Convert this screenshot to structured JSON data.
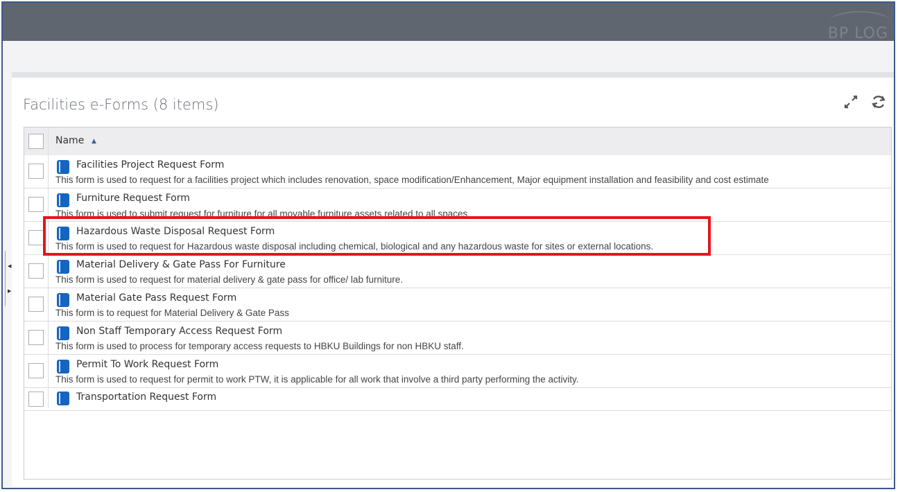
{
  "header": {
    "logo_text": "BP LOG"
  },
  "panel": {
    "title": "Facilities e-Forms (8 items)",
    "expand_icon": "expand-icon",
    "refresh_icon": "refresh-icon"
  },
  "grid": {
    "column_name": "Name",
    "sort": "ascending",
    "rows": [
      {
        "name": "Facilities Project Request Form",
        "description": "This form is used to request for a facilities project which includes renovation, space modification/Enhancement, Major equipment installation and feasibility and cost estimate"
      },
      {
        "name": "Furniture Request Form",
        "description": "This form is used to submit request for furniture for all movable furniture assets related to all spaces"
      },
      {
        "name": "Hazardous Waste Disposal Request Form",
        "description": "This form is used to request for Hazardous waste disposal including chemical, biological and any hazardous waste for sites or external locations."
      },
      {
        "name": "Material Delivery & Gate Pass For Furniture",
        "description": "This form is used to request for material delivery & gate pass for office/ lab furniture."
      },
      {
        "name": "Material Gate Pass Request Form",
        "description": "This form is to request for Material Delivery & Gate Pass"
      },
      {
        "name": "Non Staff Temporary Access Request Form",
        "description": "This form is used to process for temporary access requests to HBKU Buildings for non HBKU staff."
      },
      {
        "name": "Permit To Work Request Form",
        "description": "This form is used to request for permit to work PTW, it is applicable for all work that involve a third party performing the activity."
      },
      {
        "name": "Transportation Request Form",
        "description": ""
      }
    ]
  },
  "colors": {
    "topbar": "#5f6670",
    "icon_blue": "#1565c0",
    "highlight": "#e8141b"
  }
}
